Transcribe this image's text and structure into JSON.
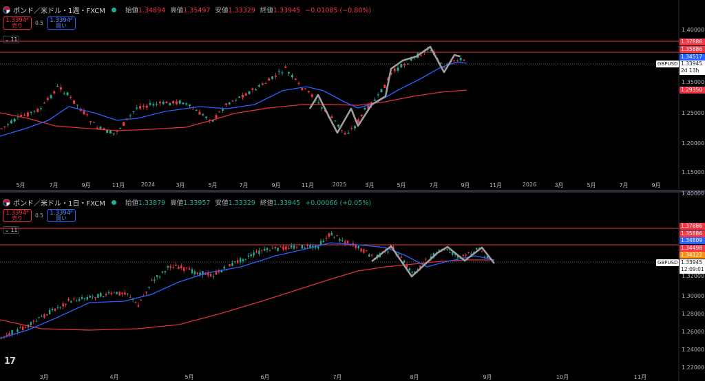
{
  "colors": {
    "up": "#22ab94",
    "down": "#f23645",
    "ma_fast": "#2962ff",
    "ma_slow": "#e0333a",
    "pattern": "#9e9e9e",
    "hline": "#f23645"
  },
  "pane1": {
    "symbol": "ポンド／米ドル・1週・FXCM",
    "ohlc": {
      "open_label": "始値",
      "open": "1.34894",
      "high_label": "高値",
      "high": "1.35497",
      "low_label": "安値",
      "low": "1.33329",
      "close_label": "終値",
      "close": "1.33945",
      "change": "−0.01085 (−0.80%)"
    },
    "sell": {
      "price": "1.3394⁴",
      "label": "売り"
    },
    "buy": {
      "price": "1.3394⁹",
      "label": "買い"
    },
    "spread": "0.5",
    "collapse": "11",
    "price_labels": [
      "1.37886",
      "1.35886",
      "1.34517",
      "1.29350"
    ],
    "symbol_tag": "GBPUSD",
    "current": {
      "price": "1.33945",
      "countdown": "2d 13h"
    },
    "yaxis": [
      "1.40000",
      "1.35000",
      "1.30000",
      "1.25000",
      "1.20000",
      "1.15000"
    ],
    "xaxis": [
      "5月",
      "7月",
      "9月",
      "11月",
      "2024",
      "3月",
      "5月",
      "7月",
      "9月",
      "11月",
      "2025",
      "3月",
      "5月",
      "7月",
      "9月",
      "11月",
      "2026",
      "3月",
      "5月",
      "7月",
      "9月"
    ],
    "chart_data": {
      "type": "candlestick",
      "scale": "linear",
      "ylim": [
        1.13,
        1.42
      ],
      "hlines": [
        1.37886,
        1.35886
      ],
      "current_price": 1.33945
    }
  },
  "pane2": {
    "symbol": "ポンド／米ドル・1日・FXCM",
    "ohlc": {
      "open_label": "始値",
      "open": "1.33879",
      "high_label": "高値",
      "high": "1.33957",
      "low_label": "安値",
      "low": "1.33329",
      "close_label": "終値",
      "close": "1.33945",
      "change": "+0.00066 (+0.05%)"
    },
    "sell": {
      "price": "1.3394⁴",
      "label": "売り"
    },
    "buy": {
      "price": "1.3394⁹",
      "label": "買い"
    },
    "spread": "0.5",
    "collapse": "11",
    "price_labels": [
      "1.37886",
      "1.35886",
      "1.34809",
      "1.34498",
      "1.34122"
    ],
    "symbol_tag": "GBPUSD",
    "current": {
      "price": "1.33945",
      "countdown": "12:09:01"
    },
    "yaxis": [
      "1.40000",
      "1.38000",
      "1.36000",
      "1.34000",
      "1.32000",
      "1.30000",
      "1.28000",
      "1.26000",
      "1.24000",
      "1.22000"
    ],
    "xaxis": [
      "3月",
      "4月",
      "5月",
      "6月",
      "7月",
      "8月",
      "9月",
      "10月",
      "11月"
    ],
    "chart_data": {
      "type": "candlestick",
      "scale": "linear",
      "ylim": [
        1.215,
        1.405
      ],
      "hlines": [
        1.37886,
        1.35886
      ],
      "current_price": 1.33945
    }
  },
  "logo": "17"
}
